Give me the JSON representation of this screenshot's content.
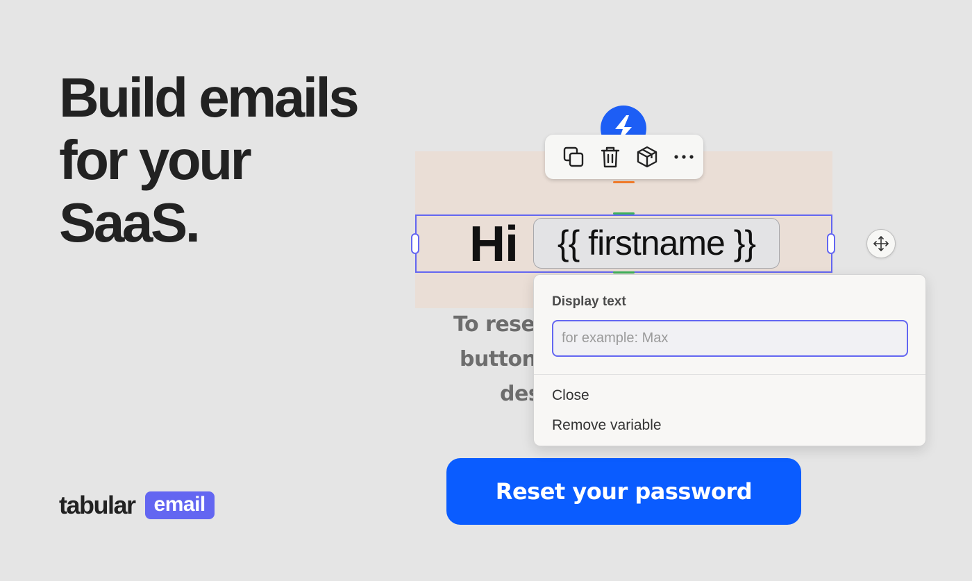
{
  "hero": {
    "line1": "Build emails",
    "line2": "for your",
    "line3": "SaaS."
  },
  "brand": {
    "wordmark": "tabular",
    "badge": "email",
    "badge_color": "#6366f1"
  },
  "toolbar": {
    "icons": [
      "duplicate-icon",
      "trash-icon",
      "package-icon",
      "more-icon"
    ]
  },
  "email": {
    "greeting": "Hi",
    "variable_chip": "{{ firstname }}",
    "body_lines": [
      "To reset",
      "button",
      "des"
    ],
    "cta_label": "Reset your password",
    "cta_color": "#0a5cff",
    "logo_color": "#1d5ef5",
    "header_bg": "#eaded6"
  },
  "popover": {
    "label": "Display text",
    "input_placeholder": "for example: Max",
    "input_value": "",
    "actions": [
      "Close",
      "Remove variable"
    ]
  },
  "selection_color": "#6366f1"
}
